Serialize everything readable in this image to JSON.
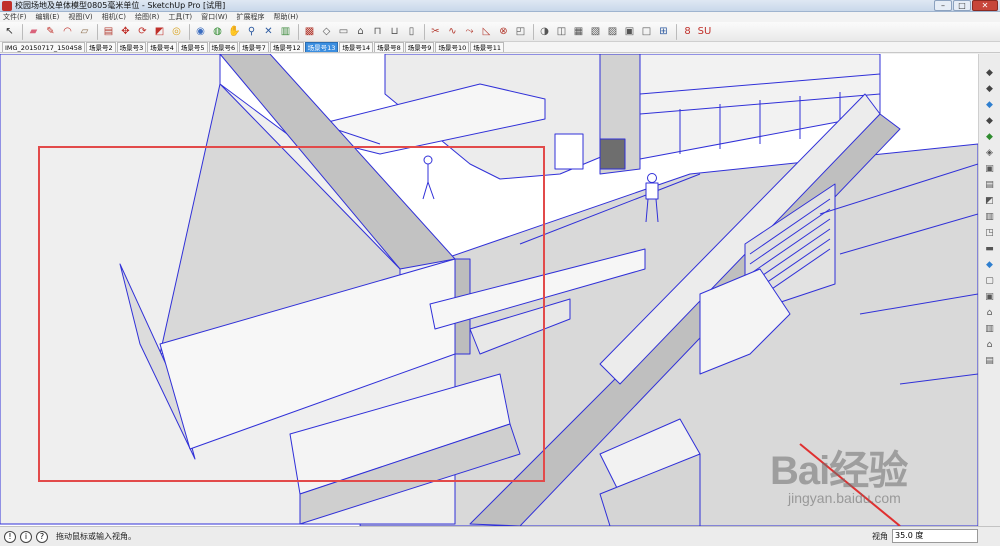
{
  "window": {
    "title": "校园场地及单体模型0805毫米单位 - SketchUp Pro [试用]",
    "controls": [
      "–",
      "□",
      "✕"
    ]
  },
  "menu": [
    "文件(F)",
    "编辑(E)",
    "视图(V)",
    "相机(C)",
    "绘图(R)",
    "工具(T)",
    "窗口(W)",
    "扩展程序",
    "帮助(H)"
  ],
  "toolbar": {
    "tools": [
      {
        "name": "select-tool-icon",
        "glyph": "↖",
        "color": "#333333"
      },
      {
        "name": "eraser-tool-icon",
        "glyph": "▰",
        "color": "#d9627a"
      },
      {
        "name": "pencil-tool-icon",
        "glyph": "✎",
        "color": "#c0302a"
      },
      {
        "name": "arc-tool-icon",
        "glyph": "◠",
        "color": "#c0302a"
      },
      {
        "name": "rectangle-tool-icon",
        "glyph": "▱",
        "color": "#8b6b4a"
      },
      {
        "name": "pushpull-tool-icon",
        "glyph": "▤",
        "color": "#b33a2f"
      },
      {
        "name": "move-tool-icon",
        "glyph": "✥",
        "color": "#c0302a"
      },
      {
        "name": "rotate-tool-icon",
        "glyph": "⟳",
        "color": "#c0302a"
      },
      {
        "name": "scale-tool-icon",
        "glyph": "◩",
        "color": "#c0302a"
      },
      {
        "name": "tape-measure-icon",
        "glyph": "◎",
        "color": "#d8a21d"
      },
      {
        "name": "paint-bucket-icon",
        "glyph": "◉",
        "color": "#3a6cc0"
      },
      {
        "name": "orbit-tool-icon",
        "glyph": "◍",
        "color": "#2e8b2e"
      },
      {
        "name": "pan-tool-icon",
        "glyph": "✋",
        "color": "#6a6a6a"
      },
      {
        "name": "zoom-tool-icon",
        "glyph": "⚲",
        "color": "#2d5aa0"
      },
      {
        "name": "zoom-extents-icon",
        "glyph": "✕",
        "color": "#2d5aa0"
      },
      {
        "name": "component-icon",
        "glyph": "▥",
        "color": "#3d8b3d"
      },
      {
        "name": "warehouse-icon",
        "glyph": "▩",
        "color": "#b33a2f"
      },
      {
        "name": "view-iso-icon",
        "glyph": "◇",
        "color": "#555555"
      },
      {
        "name": "view-top-icon",
        "glyph": "▭",
        "color": "#555555"
      },
      {
        "name": "view-front-icon",
        "glyph": "⌂",
        "color": "#555555"
      },
      {
        "name": "view-right-icon",
        "glyph": "⊓",
        "color": "#555555"
      },
      {
        "name": "view-back-icon",
        "glyph": "⊔",
        "color": "#555555"
      },
      {
        "name": "view-left-icon",
        "glyph": "▯",
        "color": "#555555"
      },
      {
        "name": "section-plane-icon",
        "glyph": "✂",
        "color": "#b33a2f"
      },
      {
        "name": "curve-tool-icon",
        "glyph": "∿",
        "color": "#b33a2f"
      },
      {
        "name": "follow-me-icon",
        "glyph": "⤳",
        "color": "#b33a2f"
      },
      {
        "name": "offset-tool-icon",
        "glyph": "◺",
        "color": "#b33a2f"
      },
      {
        "name": "intersect-icon",
        "glyph": "⊗",
        "color": "#b33a2f"
      },
      {
        "name": "solid-tools-icon",
        "glyph": "◰",
        "color": "#555555"
      },
      {
        "name": "shadow-icon",
        "glyph": "◑",
        "color": "#555555"
      },
      {
        "name": "style-xray-icon",
        "glyph": "◫",
        "color": "#555555"
      },
      {
        "name": "style-wire-icon",
        "glyph": "▦",
        "color": "#555555"
      },
      {
        "name": "style-hidden-icon",
        "glyph": "▧",
        "color": "#555555"
      },
      {
        "name": "style-shaded-icon",
        "glyph": "▨",
        "color": "#555555"
      },
      {
        "name": "style-texture-icon",
        "glyph": "▣",
        "color": "#555555"
      },
      {
        "name": "style-mono-icon",
        "glyph": "□",
        "color": "#555555"
      },
      {
        "name": "measure-icon",
        "glyph": "⊞",
        "color": "#2d5aa0"
      },
      {
        "name": "plugin-red-icon",
        "glyph": "8",
        "color": "#c0302a"
      },
      {
        "name": "plugin-su-icon",
        "glyph": "SU",
        "color": "#c0302a"
      }
    ]
  },
  "scene_tabs": [
    {
      "label": "IMG_20150717_150458",
      "active": false
    },
    {
      "label": "场景号2",
      "active": false
    },
    {
      "label": "场景号3",
      "active": false
    },
    {
      "label": "场景号4",
      "active": false
    },
    {
      "label": "场景号5",
      "active": false
    },
    {
      "label": "场景号6",
      "active": false
    },
    {
      "label": "场景号7",
      "active": false
    },
    {
      "label": "场景号12",
      "active": false
    },
    {
      "label": "场景号13",
      "active": true
    },
    {
      "label": "场景号14",
      "active": false
    },
    {
      "label": "场景号8",
      "active": false
    },
    {
      "label": "场景号9",
      "active": false
    },
    {
      "label": "场景号10",
      "active": false
    },
    {
      "label": "场景号11",
      "active": false
    }
  ],
  "sidebar_tools": [
    {
      "name": "sandbox-smoove-icon",
      "glyph": "◆",
      "color": "#444444"
    },
    {
      "name": "sandbox-stamp-icon",
      "glyph": "◆",
      "color": "#444444"
    },
    {
      "name": "sandbox-drape-icon",
      "glyph": "◆",
      "color": "#2f7fcf"
    },
    {
      "name": "sandbox-detail-icon",
      "glyph": "◆",
      "color": "#444444"
    },
    {
      "name": "sandbox-flip-icon",
      "glyph": "◆",
      "color": "#2e8b2e"
    },
    {
      "name": "layer-icon",
      "glyph": "◈",
      "color": "#555555"
    },
    {
      "name": "materials-icon",
      "glyph": "▣",
      "color": "#555555"
    },
    {
      "name": "outliner-icon",
      "glyph": "▤",
      "color": "#555555"
    },
    {
      "name": "components-icon",
      "glyph": "◩",
      "color": "#555555"
    },
    {
      "name": "scenes-icon",
      "glyph": "▥",
      "color": "#555555"
    },
    {
      "name": "styles-icon",
      "glyph": "◳",
      "color": "#555555"
    },
    {
      "name": "fog-icon",
      "glyph": "▬",
      "color": "#555555"
    },
    {
      "name": "terrain-icon",
      "glyph": "◆",
      "color": "#2f7fcf"
    },
    {
      "name": "box-icon",
      "glyph": "▢",
      "color": "#555555"
    },
    {
      "name": "cube-icon",
      "glyph": "▣",
      "color": "#555555"
    },
    {
      "name": "house-icon",
      "glyph": "⌂",
      "color": "#555555"
    },
    {
      "name": "building-icon",
      "glyph": "▥",
      "color": "#555555"
    },
    {
      "name": "shelter-icon",
      "glyph": "⌂",
      "color": "#555555"
    },
    {
      "name": "warehouse-side-icon",
      "glyph": "▤",
      "color": "#555555"
    }
  ],
  "status": {
    "message": "拖动鼠标或输入视角。",
    "vcb_label": "视角",
    "vcb_value": "35.0 度"
  },
  "watermark": {
    "brand": "Bai经验",
    "url": "jingyan.baidu.com"
  },
  "colors": {
    "edge": "#3030d8",
    "annotation": "#e24a4a",
    "arrow": "#e03030"
  }
}
